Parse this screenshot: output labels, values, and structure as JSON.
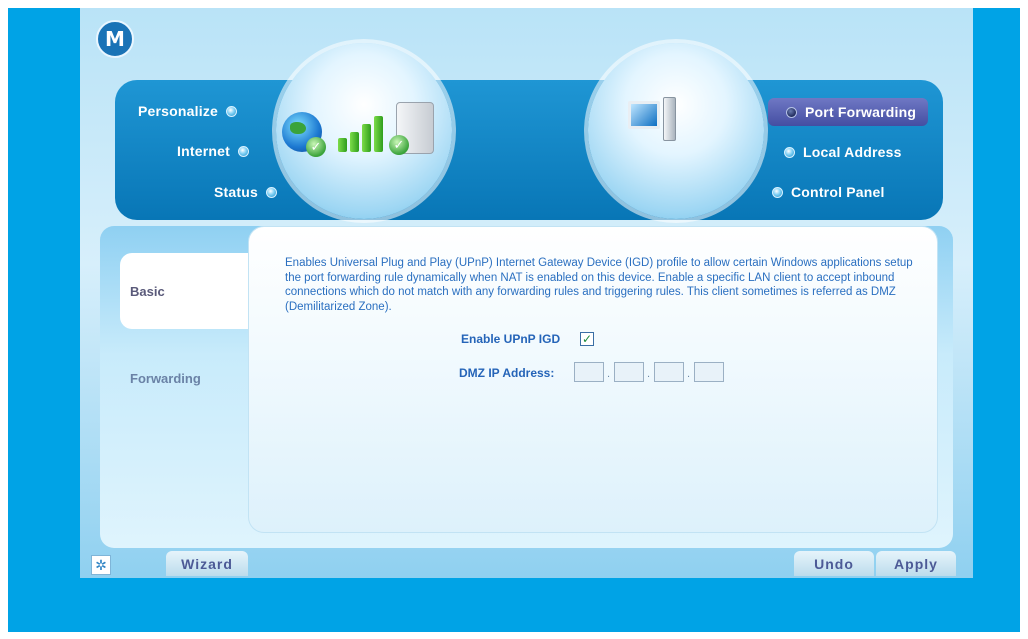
{
  "brand": {
    "logo_letter": "M"
  },
  "nav": {
    "left": [
      {
        "label": "Personalize"
      },
      {
        "label": "Internet"
      },
      {
        "label": "Status"
      }
    ],
    "right": [
      {
        "label": "Port Forwarding",
        "active": true
      },
      {
        "label": "Local Address"
      },
      {
        "label": "Control Panel"
      }
    ]
  },
  "tabs": [
    {
      "label": "Basic",
      "active": true
    },
    {
      "label": "Forwarding"
    }
  ],
  "content": {
    "description": "Enables Universal Plug and Play (UPnP) Internet Gateway Device (IGD) profile to allow certain Windows applications setup the port forwarding rule dynamically when NAT is enabled on this device. Enable a specific LAN client to accept inbound connections which do not match with any forwarding rules and triggering rules. This client sometimes is referred as DMZ (Demilitarized Zone).",
    "upnp_label": "Enable UPnP IGD",
    "upnp_checked": true,
    "dmz_label": "DMZ IP Address:",
    "dmz_octets": [
      "",
      "",
      "",
      ""
    ],
    "ip_separator": "."
  },
  "footer": {
    "wizard_label": "Wizard",
    "undo_label": "Undo",
    "apply_label": "Apply"
  },
  "colors": {
    "outer_background": "#00a3e6",
    "nav_band": "#0876b6",
    "active_pill": "#444ea2",
    "text_blue": "#2a6fc0"
  }
}
